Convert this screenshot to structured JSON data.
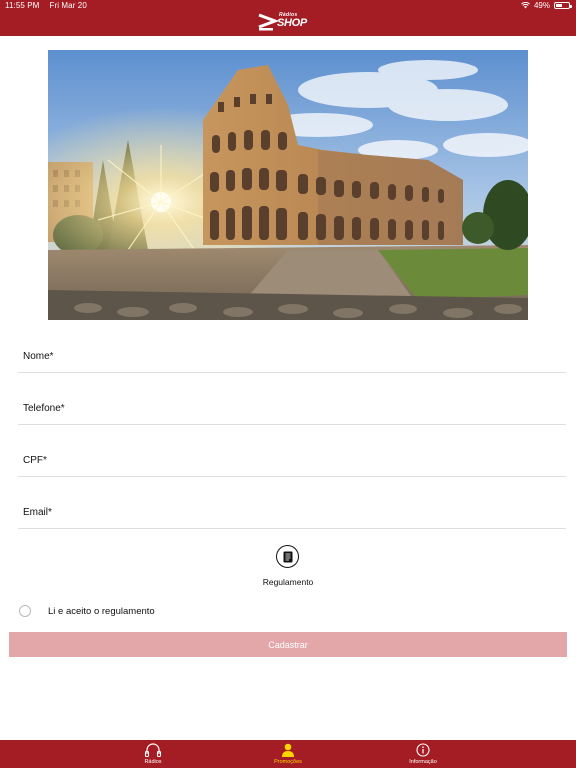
{
  "status_bar": {
    "time": "11:55 PM",
    "date": "Fri Mar 20",
    "battery": "49%",
    "battery_level": 0.49
  },
  "header": {
    "logo_small": "Rádios",
    "logo_big": "SHOP",
    "background_color": "#a51d24"
  },
  "hero": {
    "icon": "colosseum-photo"
  },
  "form": {
    "fields": [
      {
        "label": "Nome*"
      },
      {
        "label": "Telefone*"
      },
      {
        "label": "CPF*"
      },
      {
        "label": "Email*"
      }
    ],
    "regulation_label": "Regulamento",
    "agree_label": "Li e aceito o regulamento",
    "agree_checked": false,
    "submit_label": "Cadastrar",
    "submit_color": "#e3a7aa"
  },
  "tabbar": {
    "items": [
      {
        "label": "Rádios",
        "icon": "headphones-icon",
        "active": false
      },
      {
        "label": "Promoções",
        "icon": "person-icon",
        "active": true
      },
      {
        "label": "Informação",
        "icon": "info-icon",
        "active": false
      }
    ],
    "active_color": "#ffd500"
  }
}
